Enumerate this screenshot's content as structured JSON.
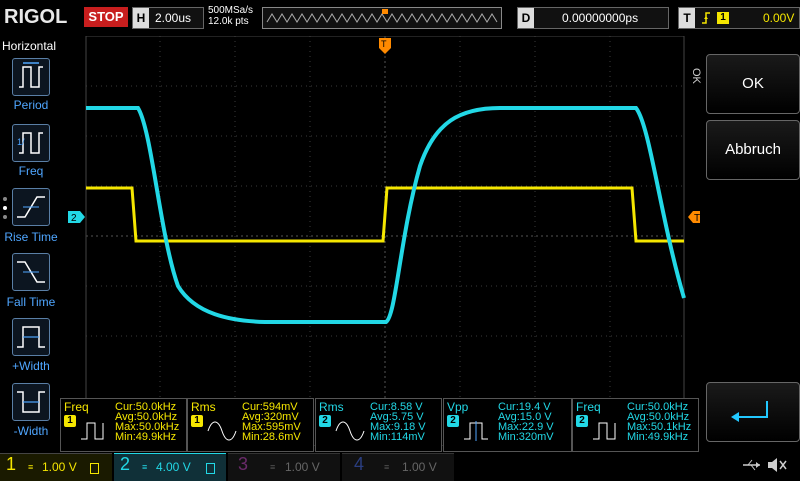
{
  "header": {
    "brand": "RIGOL",
    "run_state": "STOP",
    "timebase_label": "H",
    "timebase_value": "2.00us",
    "sample_rate": "500MSa/s",
    "memory_depth": "12.0k pts",
    "delay_label": "D",
    "delay_value": "0.00000000ps",
    "trigger_label": "T",
    "trigger_source": "1",
    "trigger_level": "0.00V"
  },
  "left_menu": {
    "title": "Horizontal",
    "items": [
      {
        "label": "Period"
      },
      {
        "label": "Freq"
      },
      {
        "label": "Rise Time"
      },
      {
        "label": "Fall Time"
      },
      {
        "label": "+Width"
      },
      {
        "label": "-Width"
      }
    ]
  },
  "right_menu": {
    "ok_vertical": "OK",
    "ok_label": "OK",
    "cancel_label": "Abbruch"
  },
  "markers": {
    "ch2_offset": "2",
    "trigger_marker": "T"
  },
  "measurements": [
    {
      "name": "Freq",
      "channel": "1",
      "cur": "Cur:50.0kHz",
      "avg": "Avg:50.0kHz",
      "max": "Max:50.0kHz",
      "min": "Min:49.9kHz"
    },
    {
      "name": "Rms",
      "channel": "1",
      "cur": "Cur:594mV",
      "avg": "Avg:320mV",
      "max": "Max:595mV",
      "min": "Min:28.6mV"
    },
    {
      "name": "Rms",
      "channel": "2",
      "cur": "Cur:8.58 V",
      "avg": "Avg:5.75 V",
      "max": "Max:9.18 V",
      "min": "Min:114mV"
    },
    {
      "name": "Vpp",
      "channel": "2",
      "cur": "Cur:19.4 V",
      "avg": "Avg:15.0 V",
      "max": "Max:22.9 V",
      "min": "Min:320mV"
    },
    {
      "name": "Freq",
      "channel": "2",
      "cur": "Cur:50.0kHz",
      "avg": "Avg:50.0kHz",
      "max": "Max:50.1kHz",
      "min": "Min:49.9kHz"
    }
  ],
  "channels": [
    {
      "num": "1",
      "scale": "1.00 V",
      "color": "#f5e600"
    },
    {
      "num": "2",
      "scale": "4.00 V",
      "color": "#22d8e6"
    },
    {
      "num": "3",
      "scale": "1.00 V",
      "color": "#c02cc0"
    },
    {
      "num": "4",
      "scale": "1.00 V",
      "color": "#3c78ff"
    }
  ],
  "colors": {
    "ch1": "#f5e600",
    "ch2": "#22d8e6",
    "trigger": "#ff8a00",
    "menu_text": "#4fa6ff"
  }
}
